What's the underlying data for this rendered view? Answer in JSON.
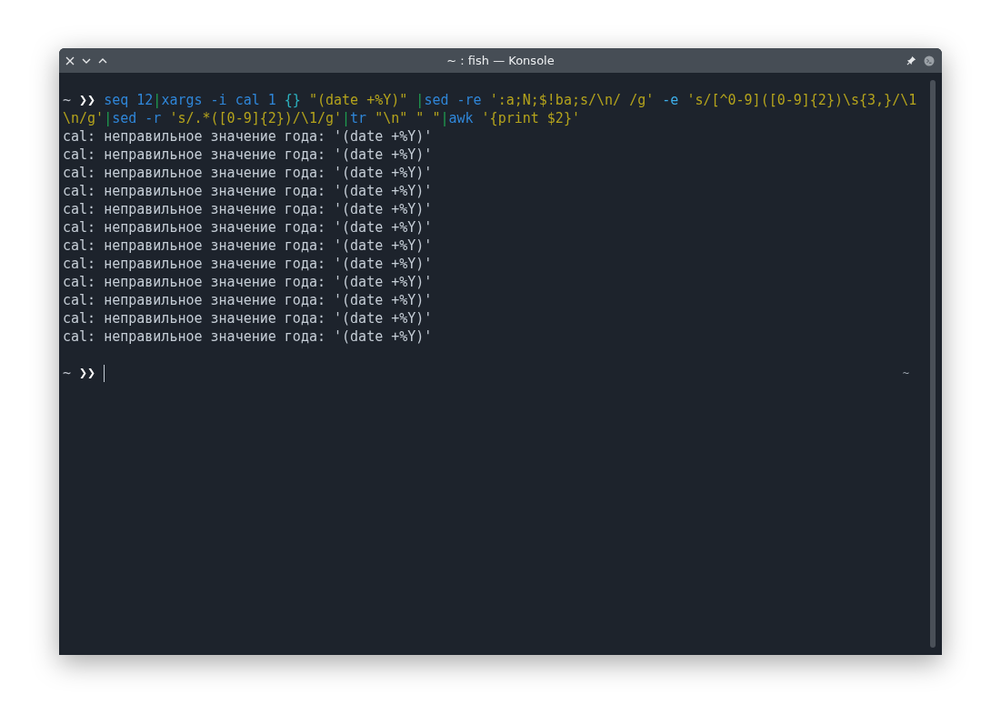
{
  "window": {
    "title": "~ : fish — Konsole"
  },
  "terminal": {
    "command_lines": [
      {
        "tokens": [
          {
            "kind": "prompt",
            "text": "~ "
          },
          {
            "kind": "arrow",
            "text": "❯❯ "
          },
          {
            "kind": "command",
            "text": "seq"
          },
          {
            "kind": "argument",
            "text": " 12"
          },
          {
            "kind": "pipe",
            "text": "|"
          },
          {
            "kind": "command",
            "text": "xargs"
          },
          {
            "kind": "argument",
            "text": " -i cal 1 "
          },
          {
            "kind": "brace",
            "text": "{}"
          },
          {
            "kind": "string",
            "text": " \"(date +%Y)\" "
          },
          {
            "kind": "pipe",
            "text": "|"
          },
          {
            "kind": "command",
            "text": "sed"
          },
          {
            "kind": "argument",
            "text": " -re "
          },
          {
            "kind": "string",
            "text": "':a;N;$!ba;s/\\n/ /g' "
          },
          {
            "kind": "option",
            "text": "-e "
          },
          {
            "kind": "string",
            "text": "'s/[^0-9]([0-9]{2})\\s{3,}/\\1"
          }
        ]
      },
      {
        "tokens": [
          {
            "kind": "string",
            "text": "\\n/g'"
          },
          {
            "kind": "pipe",
            "text": "|"
          },
          {
            "kind": "command",
            "text": "sed"
          },
          {
            "kind": "argument",
            "text": " -r "
          },
          {
            "kind": "string",
            "text": "'s/.*([0-9]{2})/\\1/g'"
          },
          {
            "kind": "pipe",
            "text": "|"
          },
          {
            "kind": "command",
            "text": "tr"
          },
          {
            "kind": "string",
            "text": " \"\\n\" \" \""
          },
          {
            "kind": "pipe",
            "text": "|"
          },
          {
            "kind": "command",
            "text": "awk"
          },
          {
            "kind": "string",
            "text": " '{print $2}'"
          }
        ]
      }
    ],
    "output": [
      "cal: неправильное значение года: '(date +%Y)'",
      "cal: неправильное значение года: '(date +%Y)'",
      "cal: неправильное значение года: '(date +%Y)'",
      "cal: неправильное значение года: '(date +%Y)'",
      "cal: неправильное значение года: '(date +%Y)'",
      "cal: неправильное значение года: '(date +%Y)'",
      "cal: неправильное значение года: '(date +%Y)'",
      "cal: неправильное значение года: '(date +%Y)'",
      "cal: неправильное значение года: '(date +%Y)'",
      "cal: неправильное значение года: '(date +%Y)'",
      "cal: неправильное значение года: '(date +%Y)'",
      "cal: неправильное значение года: '(date +%Y)'"
    ],
    "prompt": {
      "tokens": [
        {
          "kind": "prompt",
          "text": "~ "
        },
        {
          "kind": "arrow",
          "text": "❯❯ "
        }
      ],
      "right_prompt": "~"
    }
  }
}
